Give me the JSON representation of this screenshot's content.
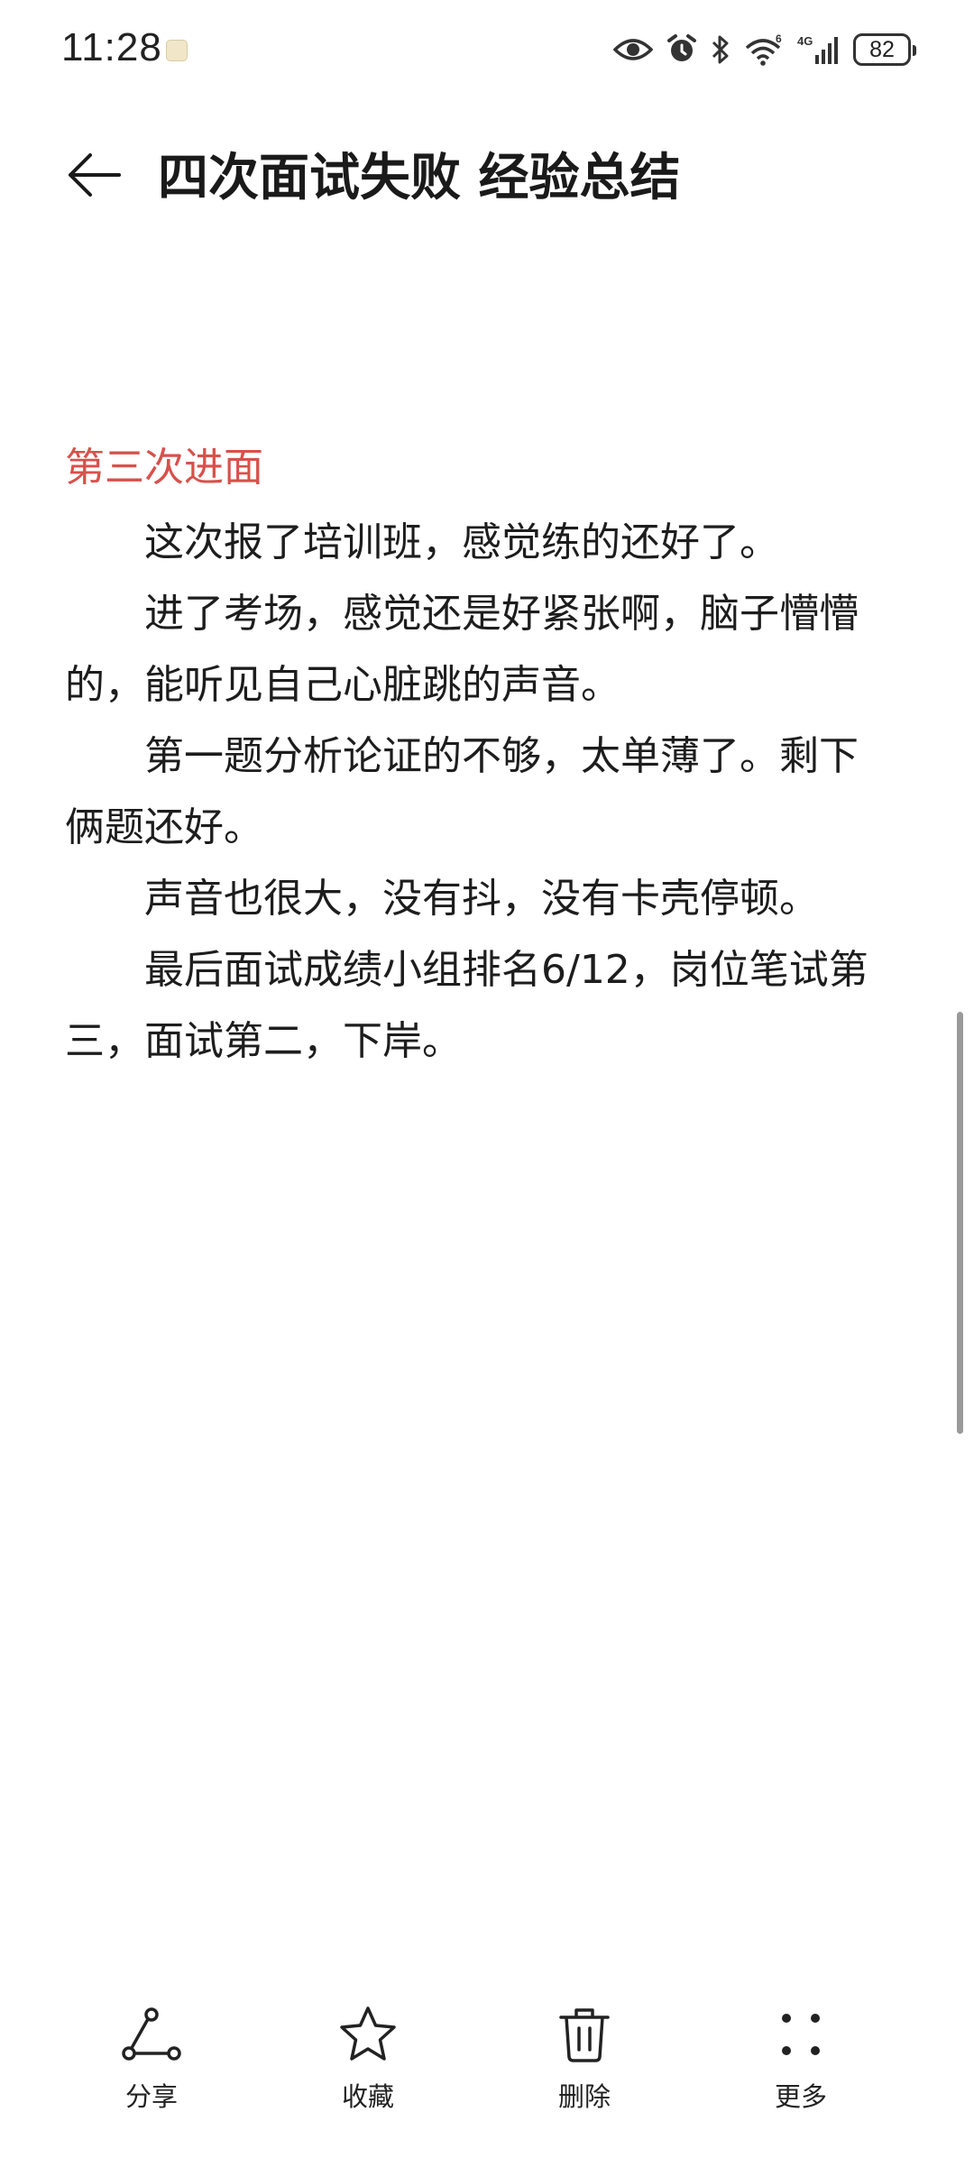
{
  "status_bar": {
    "time": "11:28",
    "battery": "82",
    "icons": [
      "eye-icon",
      "alarm-icon",
      "bluetooth-icon",
      "wifi-6-icon",
      "4g-signal-icon",
      "battery-icon"
    ],
    "network_label": "4G",
    "wifi_label": "6"
  },
  "header": {
    "title": "四次面试失败 经验总结",
    "back_icon": "arrow-left-icon"
  },
  "article": {
    "section_heading": "第三次进面",
    "heading_color": "#d9504b",
    "paragraphs": [
      "这次报了培训班，感觉练的还好了。",
      "进了考场，感觉还是好紧张啊，脑子懵懵的，能听见自己心脏跳的声音。",
      "第一题分析论证的不够，太单薄了。剩下俩题还好。",
      "声音也很大，没有抖，没有卡壳停顿。",
      "最后面试成绩小组排名6/12，岗位笔试第三，面试第二，下岸。"
    ]
  },
  "toolbar": {
    "share_label": "分享",
    "favorite_label": "收藏",
    "delete_label": "删除",
    "more_label": "更多"
  }
}
